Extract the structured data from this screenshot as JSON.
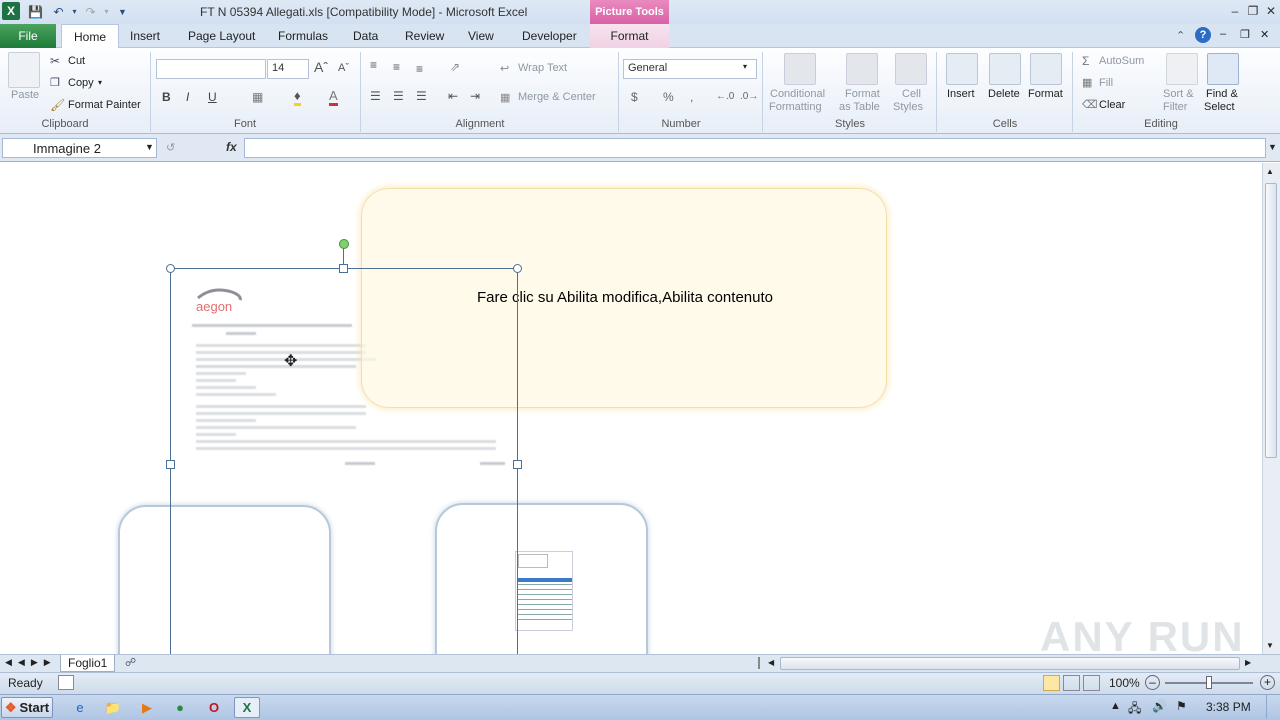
{
  "window": {
    "title": "FT N 05394 Allegati.xls  [Compatibility Mode]  -  Microsoft Excel",
    "context_tab_header": "Picture Tools"
  },
  "tabs": [
    "File",
    "Home",
    "Insert",
    "Page Layout",
    "Formulas",
    "Data",
    "Review",
    "View",
    "Developer",
    "Format"
  ],
  "ribbon": {
    "clipboard": {
      "label": "Clipboard",
      "paste": "Paste",
      "cut": "Cut",
      "copy": "Copy",
      "format_painter": "Format Painter"
    },
    "font": {
      "label": "Font",
      "font_name": "",
      "font_size": "14",
      "bold": "B",
      "italic": "I",
      "underline": "U"
    },
    "alignment": {
      "label": "Alignment",
      "wrap_text": "Wrap Text",
      "merge_center": "Merge & Center"
    },
    "number": {
      "label": "Number",
      "format": "General",
      "currency": "$",
      "percent": "%",
      "comma": ","
    },
    "styles": {
      "label": "Styles",
      "conditional": [
        "Conditional",
        "Formatting"
      ],
      "format_table": [
        "Format",
        "as Table"
      ],
      "cell_styles": [
        "Cell",
        "Styles"
      ]
    },
    "cells": {
      "label": "Cells",
      "insert": "Insert",
      "delete": "Delete",
      "format": "Format"
    },
    "editing": {
      "label": "Editing",
      "autosum": "AutoSum",
      "fill": "Fill",
      "clear": "Clear",
      "sort": [
        "Sort &",
        "Filter"
      ],
      "find": [
        "Find &",
        "Select"
      ]
    }
  },
  "formula_bar": {
    "name_box": "Immagine 2",
    "fx": "fx",
    "value": ""
  },
  "sheet": {
    "callout_text": "Fare clic su Abilita modifica,Abilita contenuto",
    "sheet_tab": "Foglio1"
  },
  "status": {
    "ready": "Ready",
    "zoom": "100%"
  },
  "taskbar": {
    "start": "Start",
    "time": "3:38 PM"
  },
  "watermark": "ANY RUN",
  "colors": {
    "file_tab": "#1e7a3a",
    "picture_tools": "#d961a6",
    "callout_fill": "#fff8e1"
  }
}
